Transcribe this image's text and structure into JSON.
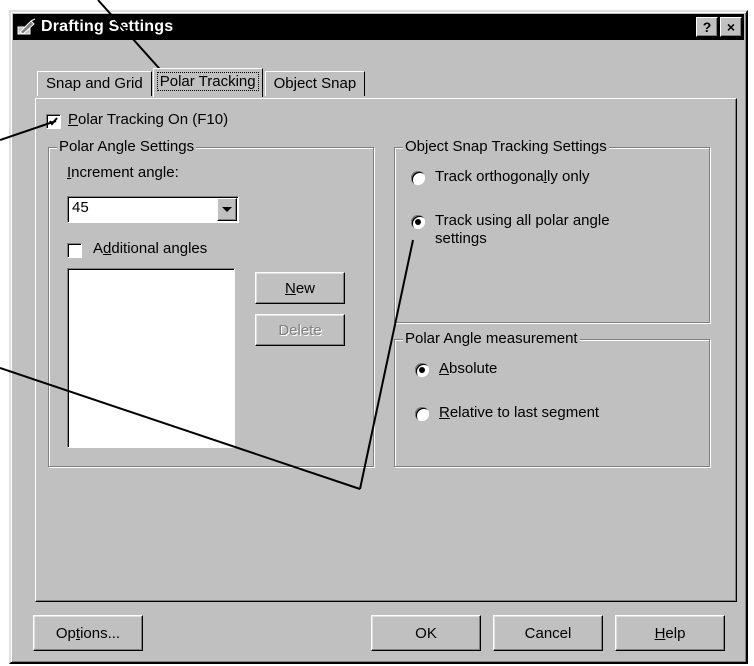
{
  "window": {
    "title": "Drafting Settings",
    "help_glyph": "?",
    "close_glyph": "×"
  },
  "tabs": [
    {
      "label": "Snap and Grid",
      "active": false
    },
    {
      "label": "Polar Tracking",
      "active": true
    },
    {
      "label": "Object Snap",
      "active": false
    }
  ],
  "polar_on": {
    "pre": "",
    "key": "P",
    "post": "olar Tracking On (F10)",
    "checked": true
  },
  "polar_angle_group": {
    "title": "Polar Angle Settings",
    "increment_label": {
      "pre": "",
      "key": "I",
      "post": "ncrement angle:"
    },
    "increment_value": "45",
    "additional": {
      "pre": "A",
      "key": "d",
      "post": "ditional angles",
      "checked": false
    },
    "new_button": {
      "pre": "",
      "key": "N",
      "post": "ew"
    },
    "delete_button": "Delete"
  },
  "object_snap_group": {
    "title": "Object Snap Tracking Settings",
    "opt1": {
      "pre": "Track orthogona",
      "key": "l",
      "post": "ly only",
      "selected": false
    },
    "opt2": {
      "line1": "Track using all polar angle",
      "line2_pre": "settin",
      "line2_key": "g",
      "line2_post": "s",
      "selected": true
    }
  },
  "measure_group": {
    "title": "Polar Angle measurement",
    "abs": {
      "pre": "",
      "key": "A",
      "post": "bsolute",
      "selected": true
    },
    "rel": {
      "pre": "",
      "key": "R",
      "post": "elative to last segment",
      "selected": false
    }
  },
  "footer": {
    "options": {
      "pre": "Op",
      "key": "t",
      "post": "ions..."
    },
    "ok": "OK",
    "cancel": "Cancel",
    "help": {
      "pre": "",
      "key": "H",
      "post": "elp"
    }
  },
  "colors": {
    "face": "#c0c0c0",
    "titlebar": "#000000",
    "shadow": "#808080"
  }
}
